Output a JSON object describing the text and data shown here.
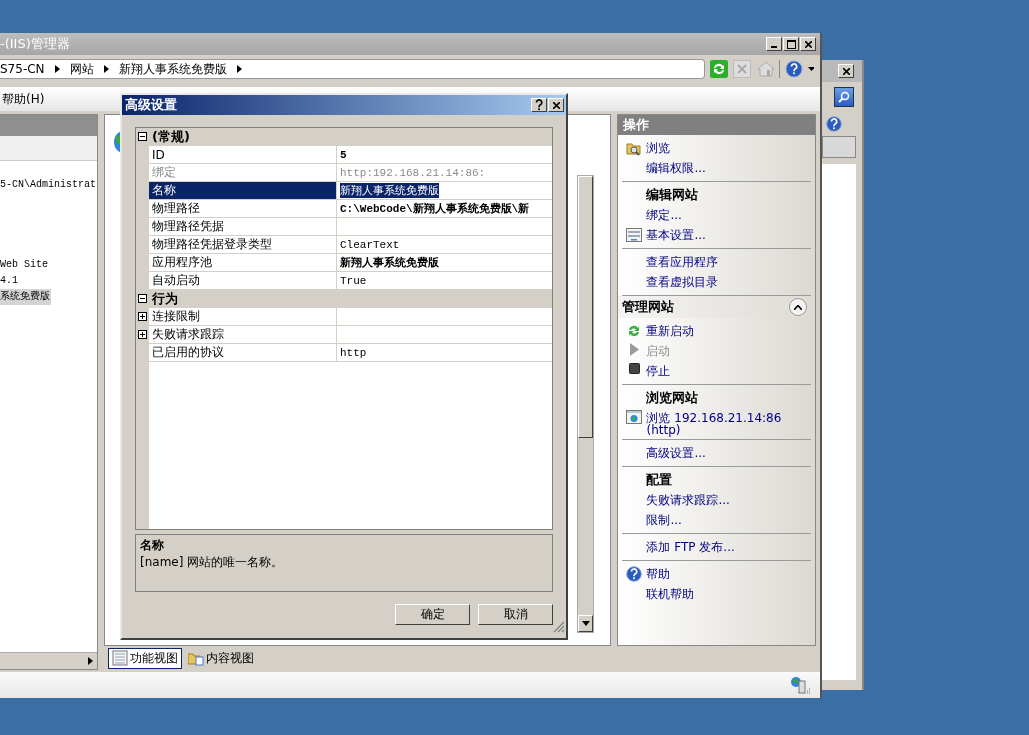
{
  "window": {
    "title": "-(IIS)管理器"
  },
  "breadcrumb": [
    "S75-CN",
    "网站",
    "新翔人事系统免费版"
  ],
  "menu": [
    "帮助(H)"
  ],
  "tree": [
    {
      "label": "5-CN\\Administrat",
      "selected": false
    },
    {
      "label": "Web Site",
      "selected": false
    },
    {
      "label": "4.1",
      "selected": false
    },
    {
      "label": "系统免费版",
      "selected": true
    }
  ],
  "view_tabs": [
    {
      "label": "功能视图",
      "kind": "features",
      "selected": true
    },
    {
      "label": "内容视图",
      "kind": "content",
      "selected": false
    }
  ],
  "actions": {
    "title": "操作",
    "sections": [
      {
        "groups": [
          {
            "items": [
              {
                "label": "浏览",
                "kind": "browse",
                "disabled": false
              },
              {
                "label": "编辑权限...",
                "disabled": false
              }
            ]
          },
          {
            "heading": "编辑网站",
            "items": [
              {
                "label": "绑定...",
                "disabled": false
              },
              {
                "label": "基本设置...",
                "kind": "settings",
                "disabled": false
              }
            ]
          },
          {
            "items": [
              {
                "label": "查看应用程序",
                "disabled": false
              },
              {
                "label": "查看虚拟目录",
                "disabled": false
              }
            ]
          }
        ]
      },
      {
        "title": "管理网站",
        "expanded": true,
        "groups": [
          {
            "items": [
              {
                "label": "重新启动",
                "kind": "restart",
                "disabled": false
              },
              {
                "label": "启动",
                "kind": "start",
                "disabled": true
              },
              {
                "label": "停止",
                "kind": "stop",
                "disabled": false
              }
            ]
          },
          {
            "heading": "浏览网站",
            "items": [
              {
                "label": "浏览 192.168.21.14:86 (http)",
                "kind": "site",
                "disabled": false
              }
            ]
          },
          {
            "items": [
              {
                "label": "高级设置...",
                "disabled": false
              }
            ]
          },
          {
            "heading": "配置",
            "items": [
              {
                "label": "失败请求跟踪...",
                "disabled": false
              },
              {
                "label": "限制...",
                "disabled": false
              }
            ]
          },
          {
            "items": [
              {
                "label": "添加 FTP 发布...",
                "disabled": false
              }
            ]
          },
          {
            "items": [
              {
                "label": "帮助",
                "kind": "help",
                "disabled": false
              },
              {
                "label": "联机帮助",
                "disabled": false
              }
            ]
          }
        ]
      }
    ]
  },
  "dialog": {
    "title": "高级设置",
    "categories": [
      {
        "name": "(常规)",
        "expanded": true,
        "rows": [
          {
            "name": "ID",
            "value": "5",
            "bold": true,
            "disabled": false,
            "selected": false
          },
          {
            "name": "绑定",
            "value": "http:192.168.21.14:86:",
            "bold": false,
            "disabled": true,
            "selected": false
          },
          {
            "name": "名称",
            "value": "新翔人事系统免费版",
            "bold": false,
            "disabled": false,
            "selected": true
          },
          {
            "name": "物理路径",
            "value": "C:\\WebCode\\新翔人事系统免费版\\新",
            "bold": true,
            "disabled": false,
            "selected": false
          },
          {
            "name": "物理路径凭据",
            "disabled": false,
            "selected": false
          },
          {
            "name": "物理路径凭据登录类型",
            "value": "ClearText",
            "bold": false,
            "disabled": false,
            "selected": false
          },
          {
            "name": "应用程序池",
            "value": "新翔人事系统免费版",
            "bold": true,
            "disabled": false,
            "selected": false
          },
          {
            "name": "自动启动",
            "value": "True",
            "bold": false,
            "disabled": false,
            "selected": false
          }
        ]
      },
      {
        "name": "行为",
        "expanded": true,
        "rows": [
          {
            "name": "连接限制",
            "expandable": true,
            "disabled": false,
            "selected": false
          },
          {
            "name": "失败请求跟踪",
            "expandable": true,
            "disabled": false,
            "selected": false
          },
          {
            "name": "已启用的协议",
            "value": "http",
            "bold": false,
            "disabled": false,
            "selected": false
          }
        ]
      }
    ],
    "description": {
      "title": "名称",
      "text": "[name] 网站的唯一名称。"
    },
    "buttons": [
      "确定",
      "取消"
    ]
  }
}
